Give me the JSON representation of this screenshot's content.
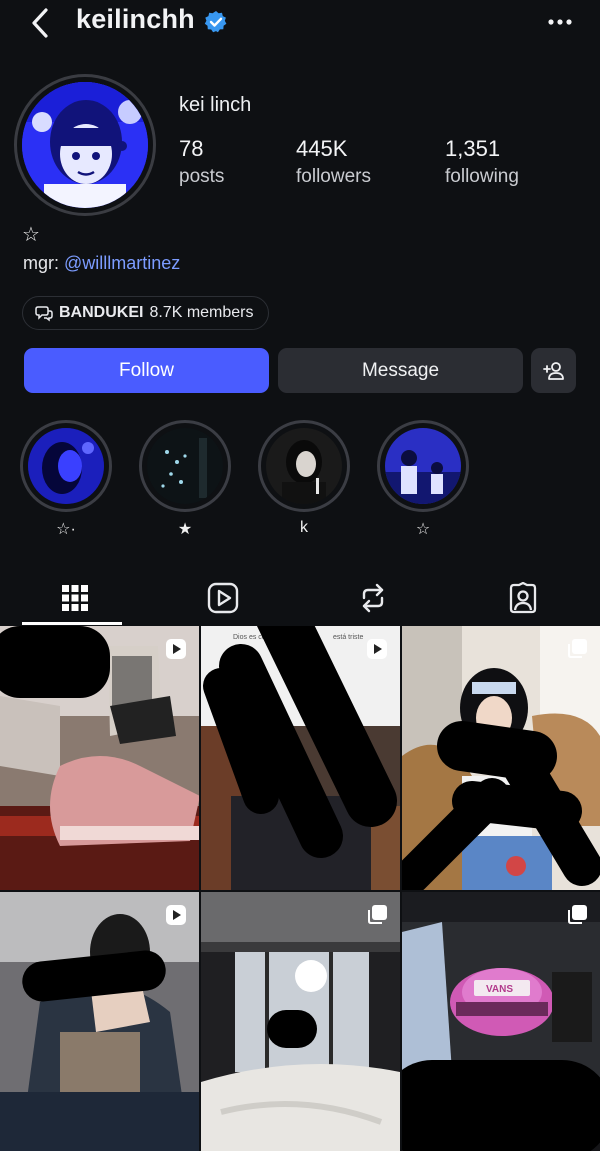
{
  "header": {
    "username": "keilinchh",
    "back_icon": "chevron-left-icon",
    "verified_icon": "verified-badge-icon",
    "more_icon": "more-dots-icon"
  },
  "profile": {
    "display_name": "kei linch",
    "stats": [
      {
        "value": "78",
        "label": "posts"
      },
      {
        "value": "445K",
        "label": "followers"
      },
      {
        "value": "1,351",
        "label": "following"
      }
    ],
    "bio_symbol": "☆",
    "mgr_prefix": "mgr: ",
    "mgr_handle": "@willlmartinez",
    "group": {
      "name": "BANDUKEI",
      "members": "8.7K members",
      "icon": "chat-bubbles-icon"
    }
  },
  "actions": {
    "follow_label": "Follow",
    "message_label": "Message",
    "add_user_icon": "add-user-icon"
  },
  "highlights": [
    {
      "label": "☆·"
    },
    {
      "label": "★"
    },
    {
      "label": "k"
    },
    {
      "label": "☆"
    }
  ],
  "tabs": [
    {
      "name": "grid",
      "icon": "grid-icon"
    },
    {
      "name": "reels",
      "icon": "reels-icon"
    },
    {
      "name": "reposts",
      "icon": "repost-icon"
    },
    {
      "name": "tagged",
      "icon": "tagged-person-icon"
    }
  ],
  "posts": [
    {
      "type": "reel",
      "badge_icon": "reel-play-icon"
    },
    {
      "type": "reel",
      "badge_icon": "reel-play-icon",
      "overlay_text_left": "Dios es con",
      "overlay_text_right": "está triste"
    },
    {
      "type": "carousel",
      "badge_icon": "carousel-icon"
    },
    {
      "type": "reel",
      "badge_icon": "reel-play-icon"
    },
    {
      "type": "carousel",
      "badge_icon": "carousel-icon"
    },
    {
      "type": "carousel",
      "badge_icon": "carousel-icon",
      "cap_text": "VANS"
    }
  ],
  "colors": {
    "background": "#0e1013",
    "follow_button": "#4a5cff",
    "secondary_button": "#2b2d33",
    "link": "#7c9cff",
    "verified": "#3897f0"
  }
}
